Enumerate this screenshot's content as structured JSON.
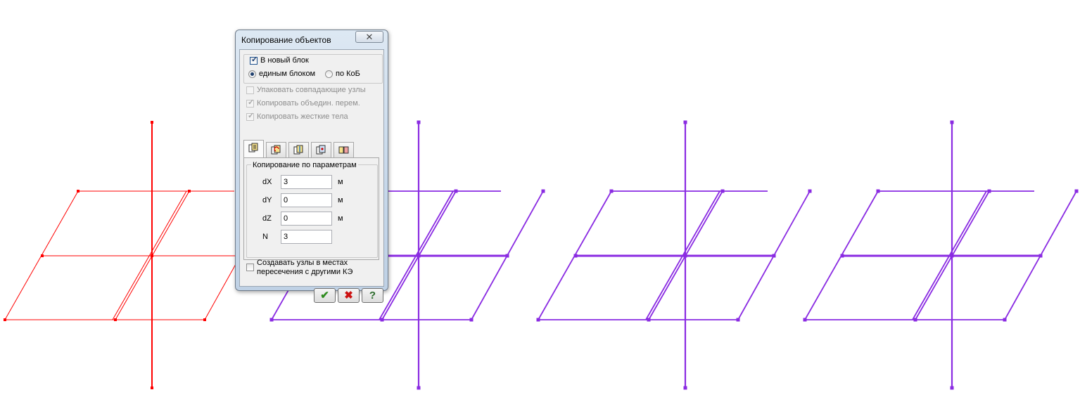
{
  "dialog": {
    "title": "Копирование объектов",
    "close_glyph": "✕",
    "new_block": {
      "label": "В новый блок",
      "checked": true
    },
    "mode": {
      "single_block": {
        "label": "единым блоком",
        "selected": true
      },
      "by_kob": {
        "label": "по КоБ",
        "selected": false
      }
    },
    "pack_nodes": {
      "label": "Упаковать совпадающие узлы",
      "checked": false,
      "enabled": false
    },
    "copy_joined": {
      "label": "Копировать объедин. перем.",
      "checked": true,
      "enabled": false
    },
    "copy_rigid": {
      "label": "Копировать жесткие тела",
      "checked": true,
      "enabled": false
    },
    "tabs": [
      {
        "icon": "copy-by-parameters-icon",
        "active": true
      },
      {
        "icon": "copy-by-rotation-icon",
        "active": false
      },
      {
        "icon": "copy-mirror-icon",
        "active": false
      },
      {
        "icon": "copy-by-nodes-icon",
        "active": false
      },
      {
        "icon": "copy-by-vector-icon",
        "active": false
      }
    ],
    "params": {
      "group_title": "Копирование по параметрам",
      "dx": {
        "label": "dX",
        "value": "3",
        "unit": "м"
      },
      "dy": {
        "label": "dY",
        "value": "0",
        "unit": "м"
      },
      "dz": {
        "label": "dZ",
        "value": "0",
        "unit": "м"
      },
      "n": {
        "label": "N",
        "value": "3"
      }
    },
    "create_nodes": {
      "label_line1": "Создавать узлы в местах",
      "label_line2": "пересечения с другими КЭ",
      "checked": false
    },
    "buttons": {
      "ok": {
        "icon": "checkmark-icon",
        "glyph": "✔"
      },
      "cancel": {
        "icon": "red-x-icon",
        "glyph": "✖"
      },
      "help": {
        "icon": "question-icon",
        "glyph": "?"
      }
    }
  },
  "scene": {
    "original_color": "#ff0000",
    "copy_color": "#8a2be2",
    "copies_count": 3
  }
}
